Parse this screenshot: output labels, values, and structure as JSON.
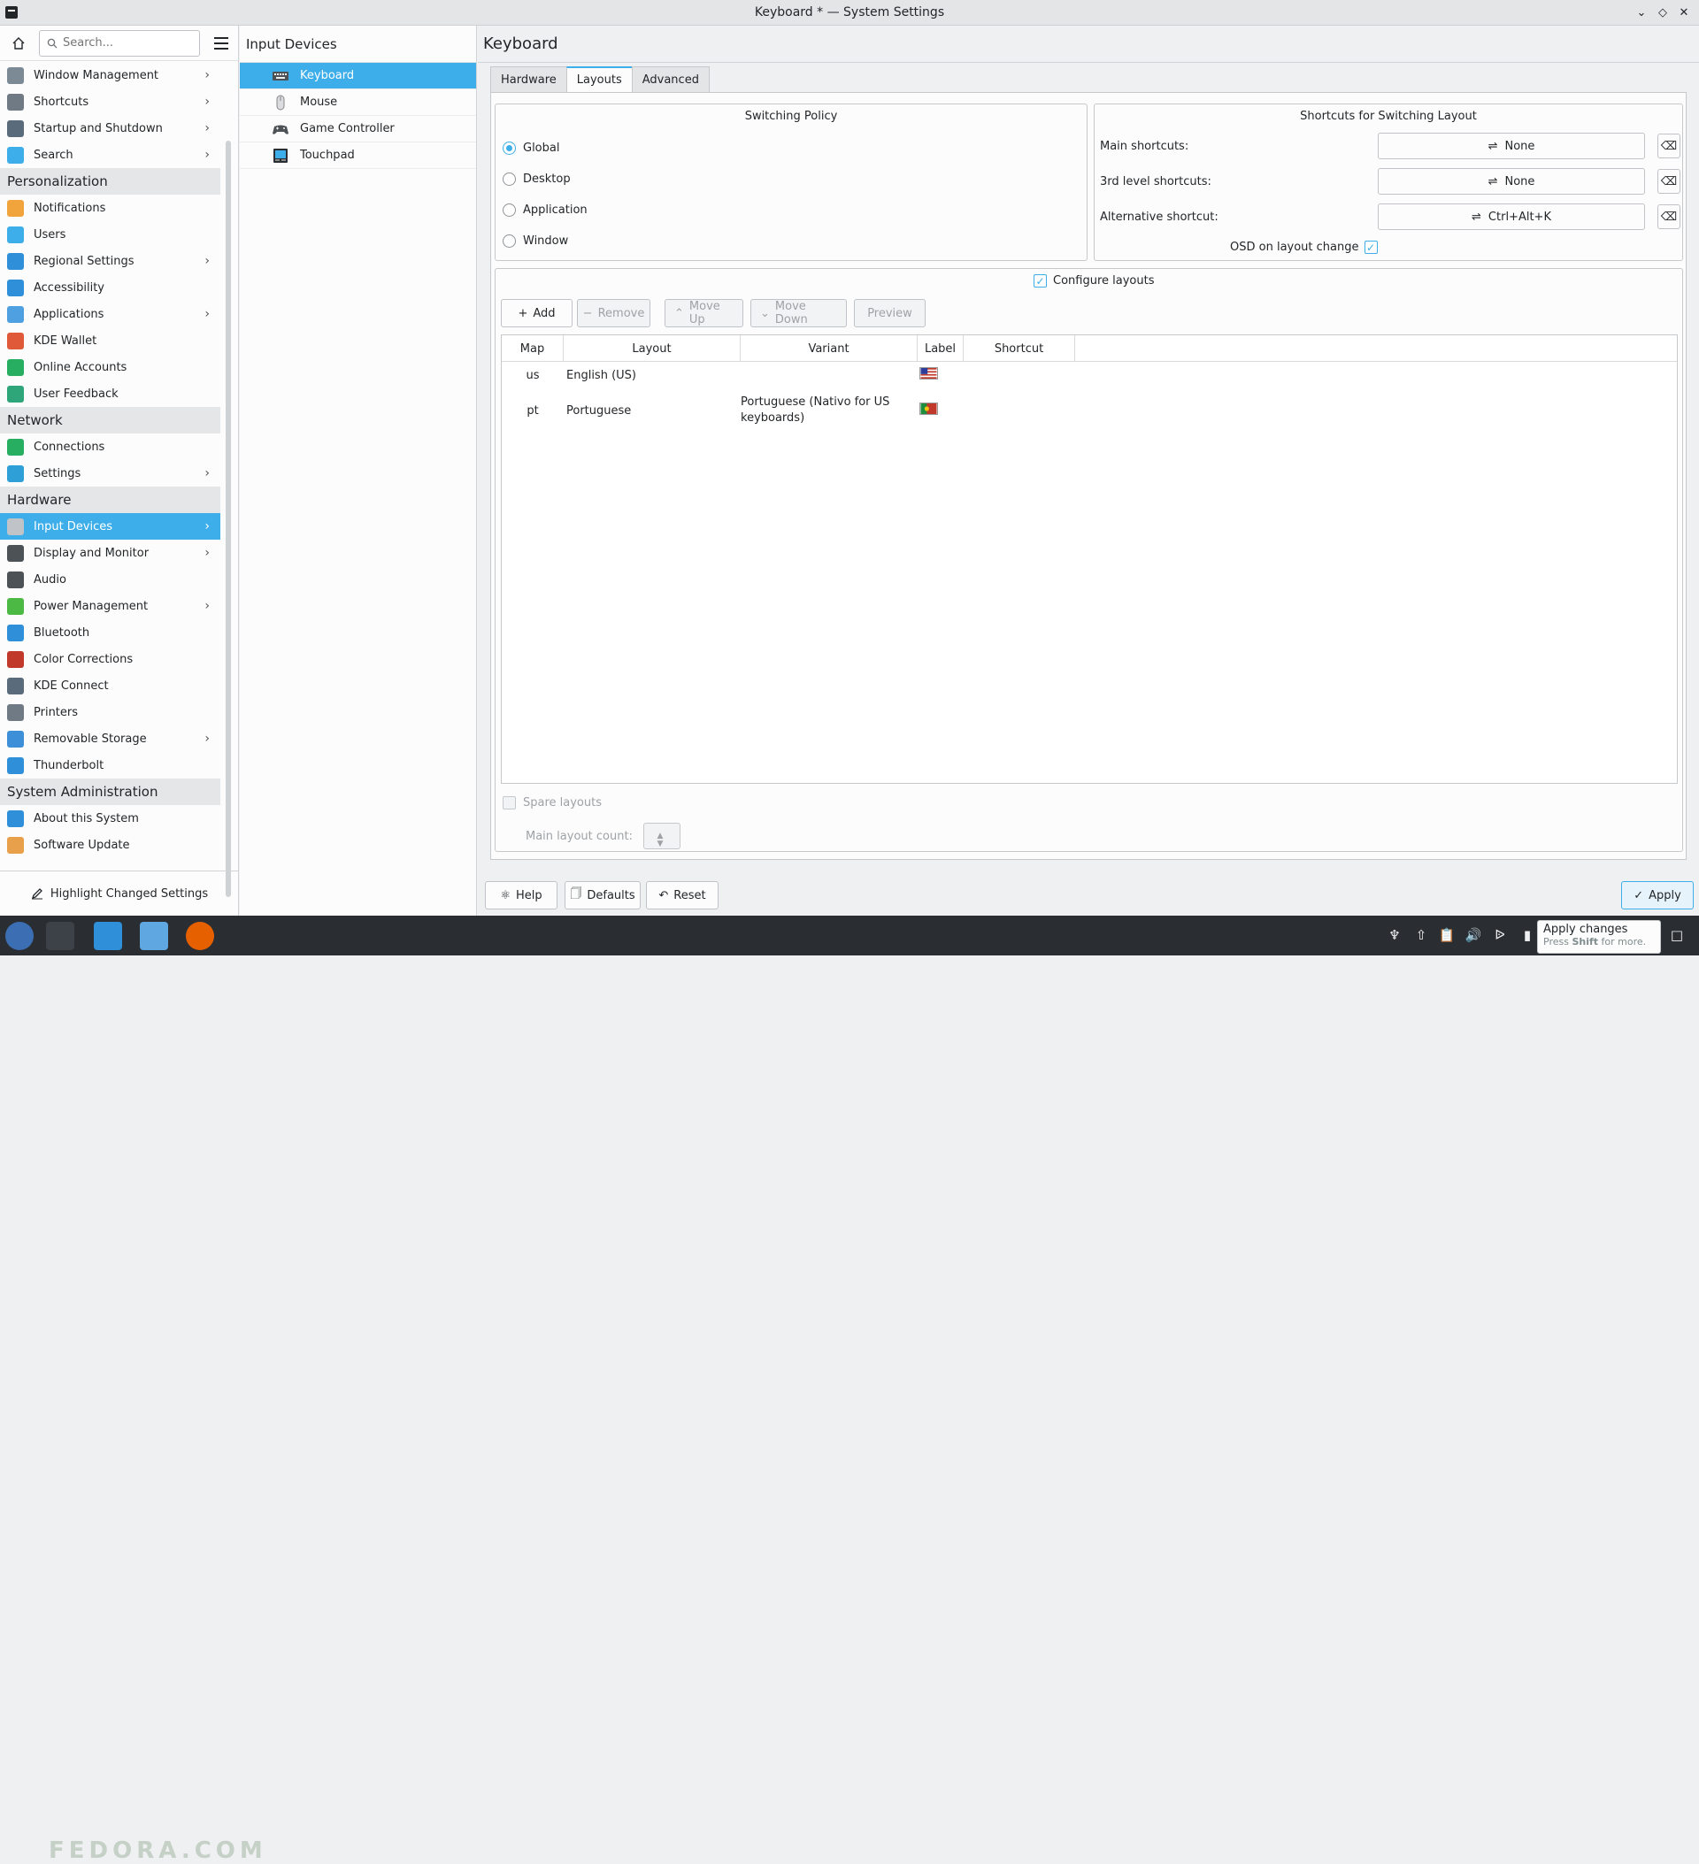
{
  "window": {
    "title": "Keyboard * — System Settings"
  },
  "search": {
    "placeholder": "Search..."
  },
  "sidebar": {
    "items": [
      {
        "label": "Window Management",
        "chev": true,
        "color": "#7c8a96"
      },
      {
        "label": "Shortcuts",
        "chev": true,
        "color": "#6f7a84"
      },
      {
        "label": "Startup and Shutdown",
        "chev": true,
        "color": "#5a6c7c"
      },
      {
        "label": "Search",
        "chev": true,
        "color": "#3daee9"
      }
    ],
    "categories": {
      "personalization": "Personalization",
      "network": "Network",
      "hardware": "Hardware",
      "sysadmin": "System Administration"
    },
    "personalization": [
      {
        "label": "Notifications",
        "chev": false,
        "color": "#f2a43c"
      },
      {
        "label": "Users",
        "chev": false,
        "color": "#3daee9"
      },
      {
        "label": "Regional Settings",
        "chev": true,
        "color": "#2f8fd8"
      },
      {
        "label": "Accessibility",
        "chev": false,
        "color": "#2f8fd8"
      },
      {
        "label": "Applications",
        "chev": true,
        "color": "#4fa0e0"
      },
      {
        "label": "KDE Wallet",
        "chev": false,
        "color": "#e05a3a"
      },
      {
        "label": "Online Accounts",
        "chev": false,
        "color": "#27ae60"
      },
      {
        "label": "User Feedback",
        "chev": false,
        "color": "#2fa57a"
      }
    ],
    "network": [
      {
        "label": "Connections",
        "chev": false,
        "color": "#27ae60"
      },
      {
        "label": "Settings",
        "chev": true,
        "color": "#2f9fd8"
      }
    ],
    "hardware": [
      {
        "label": "Input Devices",
        "chev": true,
        "color": "#c0c4c8",
        "active": true
      },
      {
        "label": "Display and Monitor",
        "chev": true,
        "color": "#4d5257"
      },
      {
        "label": "Audio",
        "chev": false,
        "color": "#4d5257"
      },
      {
        "label": "Power Management",
        "chev": true,
        "color": "#4cb944"
      },
      {
        "label": "Bluetooth",
        "chev": false,
        "color": "#2f8fd8"
      },
      {
        "label": "Color Corrections",
        "chev": false,
        "color": "#c0392b"
      },
      {
        "label": "KDE Connect",
        "chev": false,
        "color": "#5a6c7c"
      },
      {
        "label": "Printers",
        "chev": false,
        "color": "#6f7a84"
      },
      {
        "label": "Removable Storage",
        "chev": true,
        "color": "#3d8fd8"
      },
      {
        "label": "Thunderbolt",
        "chev": false,
        "color": "#2f8fd8"
      }
    ],
    "sysadmin": [
      {
        "label": "About this System",
        "chev": false,
        "color": "#2f8fd8"
      },
      {
        "label": "Software Update",
        "chev": false,
        "color": "#e8a04a"
      }
    ],
    "highlight_label": "Highlight Changed Settings"
  },
  "subpanel": {
    "title": "Input Devices",
    "items": [
      "Keyboard",
      "Mouse",
      "Game Controller",
      "Touchpad"
    ]
  },
  "main": {
    "title": "Keyboard",
    "tabs": [
      "Hardware",
      "Layouts",
      "Advanced"
    ],
    "switching": {
      "title": "Switching Policy",
      "options": [
        "Global",
        "Desktop",
        "Application",
        "Window"
      ],
      "selected": "Global"
    },
    "shortcuts": {
      "title": "Shortcuts for Switching Layout",
      "main_label": "Main shortcuts:",
      "main_value": "None",
      "third_label": "3rd level shortcuts:",
      "third_value": "None",
      "alt_label": "Alternative shortcut:",
      "alt_value": "Ctrl+Alt+K",
      "osd_label": "OSD on layout change",
      "osd_checked": true
    },
    "configure_label": "Configure layouts",
    "buttons": {
      "add": "Add",
      "remove": "Remove",
      "moveup": "Move Up",
      "movedown": "Move Down",
      "preview": "Preview"
    },
    "table": {
      "headers": [
        "Map",
        "Layout",
        "Variant",
        "Label",
        "Shortcut"
      ],
      "rows": [
        {
          "map": "us",
          "layout": "English (US)",
          "variant": "",
          "label": "us-flag"
        },
        {
          "map": "pt",
          "layout": "Portuguese",
          "variant1": "Portuguese (Nativo for US",
          "variant2": "keyboards)",
          "label": "pt-flag"
        }
      ]
    },
    "spare_label": "Spare layouts",
    "main_count_label": "Main layout count:"
  },
  "footer": {
    "help": "Help",
    "defaults": "Defaults",
    "reset": "Reset",
    "apply": "Apply"
  },
  "tooltip": {
    "line1": "Apply changes",
    "line2a": "Press",
    "line2b": "Shift",
    "line2c": "for more."
  },
  "watermark": "FEDORA.COM"
}
